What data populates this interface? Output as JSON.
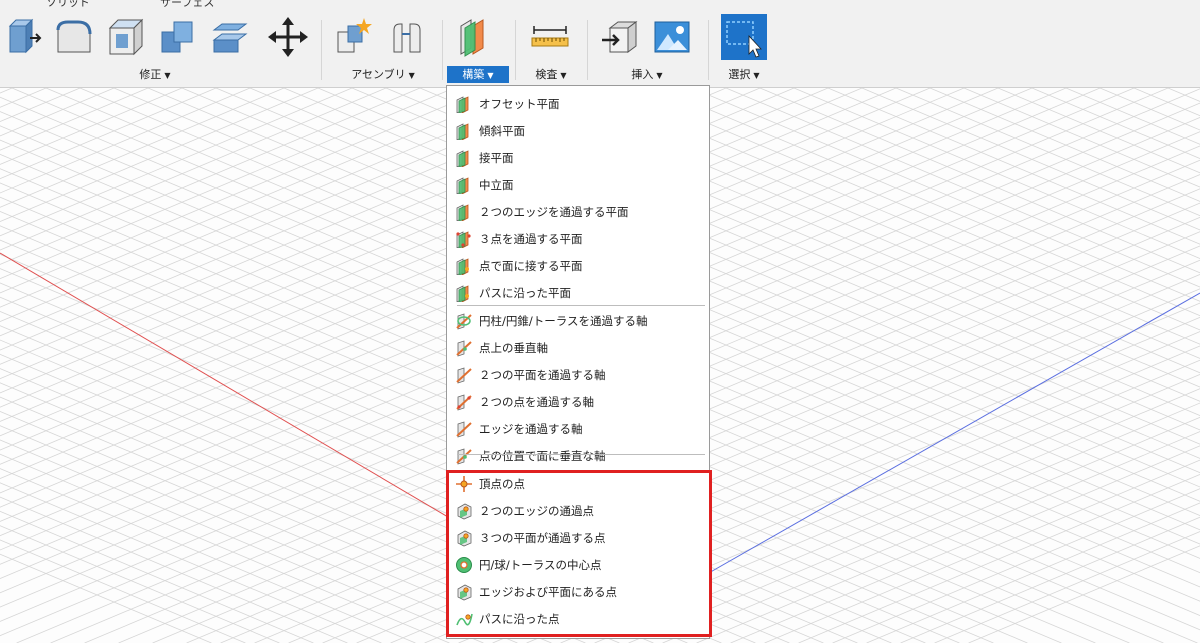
{
  "toolbar": {
    "tabs": [
      {
        "label": "ソリッド"
      },
      {
        "label": "サーフェス"
      }
    ],
    "groups": [
      {
        "key": "modify",
        "label": "修正",
        "active": false
      },
      {
        "key": "assemble",
        "label": "アセンブリ",
        "active": false
      },
      {
        "key": "construct",
        "label": "構築",
        "active": true
      },
      {
        "key": "inspect",
        "label": "検査",
        "active": false
      },
      {
        "key": "insert",
        "label": "挿入",
        "active": false
      },
      {
        "key": "select",
        "label": "選択",
        "active": false
      }
    ],
    "caret": "▼",
    "tools": [
      {
        "name": "press-pull-icon"
      },
      {
        "name": "fillet-icon"
      },
      {
        "name": "shell-icon"
      },
      {
        "name": "combine-icon"
      },
      {
        "name": "offset-face-icon"
      },
      {
        "name": "move-icon"
      },
      {
        "name": "new-component-icon"
      },
      {
        "name": "joint-icon"
      },
      {
        "name": "offset-plane-icon"
      },
      {
        "name": "measure-icon"
      },
      {
        "name": "insert-derive-icon"
      },
      {
        "name": "insert-image-icon"
      },
      {
        "name": "window-select-icon"
      }
    ]
  },
  "construct_menu": {
    "items": [
      {
        "label": "オフセット平面",
        "icon": "offset-plane-icon"
      },
      {
        "label": "傾斜平面",
        "icon": "plane-at-angle-icon"
      },
      {
        "label": "接平面",
        "icon": "tangent-plane-icon"
      },
      {
        "label": "中立面",
        "icon": "midplane-icon"
      },
      {
        "label": "２つのエッジを通過する平面",
        "icon": "plane-through-two-edges-icon"
      },
      {
        "label": "３点を通過する平面",
        "icon": "plane-through-three-points-icon"
      },
      {
        "label": "点で面に接する平面",
        "icon": "plane-tangent-at-point-icon"
      },
      {
        "label": "パスに沿った平面",
        "icon": "plane-along-path-icon"
      },
      {
        "label": "円柱/円錐/トーラスを通過する軸",
        "icon": "axis-through-cylinder-icon"
      },
      {
        "label": "点上の垂直軸",
        "icon": "axis-perpendicular-at-point-icon"
      },
      {
        "label": "２つの平面を通過する軸",
        "icon": "axis-through-two-planes-icon"
      },
      {
        "label": "２つの点を通過する軸",
        "icon": "axis-through-two-points-icon"
      },
      {
        "label": "エッジを通過する軸",
        "icon": "axis-through-edge-icon"
      },
      {
        "label": "点の位置で面に垂直な軸",
        "icon": "axis-perpendicular-to-face-icon"
      },
      {
        "label": "頂点の点",
        "icon": "point-at-vertex-icon"
      },
      {
        "label": "２つのエッジの通過点",
        "icon": "point-through-two-edges-icon"
      },
      {
        "label": "３つの平面が通過する点",
        "icon": "point-through-three-planes-icon"
      },
      {
        "label": "円/球/トーラスの中心点",
        "icon": "point-at-center-icon"
      },
      {
        "label": "エッジおよび平面にある点",
        "icon": "point-edge-and-plane-icon"
      },
      {
        "label": "パスに沿った点",
        "icon": "point-along-path-icon"
      }
    ]
  },
  "colors": {
    "accent": "#1e73c9",
    "highlight": "#e02020",
    "x_axis": "#e05050",
    "z_axis": "#5a6ee0",
    "grid": "#d6d6d6"
  }
}
